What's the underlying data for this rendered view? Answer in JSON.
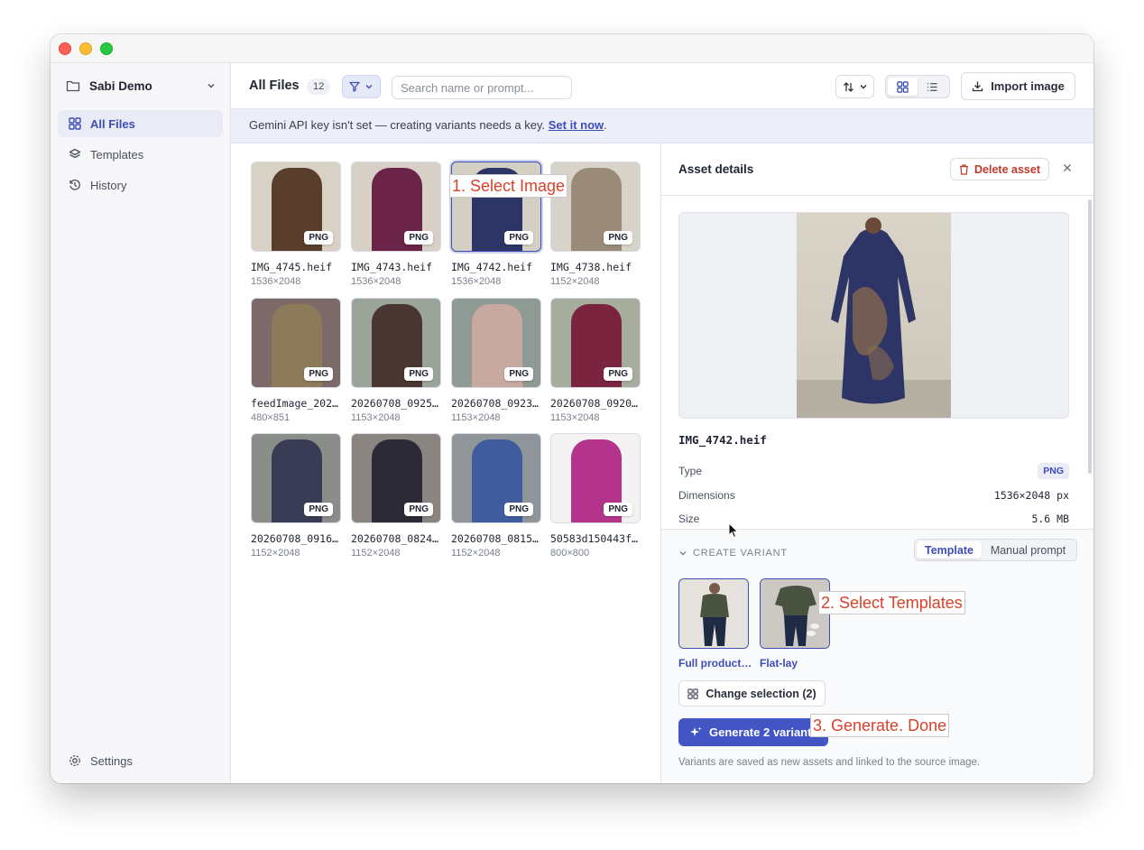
{
  "sidebar": {
    "workspace": "Sabi Demo",
    "items": [
      {
        "label": "All Files",
        "icon": "grid-icon",
        "active": true
      },
      {
        "label": "Templates",
        "icon": "layers-icon",
        "active": false
      },
      {
        "label": "History",
        "icon": "history-icon",
        "active": false
      }
    ],
    "settings_label": "Settings"
  },
  "toolbar": {
    "title": "All Files",
    "count": "12",
    "search_placeholder": "Search name or prompt...",
    "import_label": "Import image"
  },
  "banner": {
    "text": "Gemini API key isn't set — creating variants needs a key. ",
    "link": "Set it now",
    "tail": "."
  },
  "files": [
    {
      "name": "IMG_4745.heif",
      "dims": "1536×2048",
      "type": "PNG",
      "color": "#5a3e2c",
      "bg": "#d8d2c6"
    },
    {
      "name": "IMG_4743.heif",
      "dims": "1536×2048",
      "type": "PNG",
      "color": "#6b2448",
      "bg": "#d6d0c6"
    },
    {
      "name": "IMG_4742.heif",
      "dims": "1536×2048",
      "type": "PNG",
      "color": "#2c3566",
      "bg": "#d4cfc3",
      "selected": true
    },
    {
      "name": "IMG_4738.heif",
      "dims": "1152×2048",
      "type": "PNG",
      "color": "#9a8b79",
      "bg": "#d8d3ca"
    },
    {
      "name": "feedImage_202…",
      "dims": "480×851",
      "type": "PNG",
      "color": "#8c7a5a",
      "bg": "#7b6a68"
    },
    {
      "name": "20260708_0925…",
      "dims": "1153×2048",
      "type": "PNG",
      "color": "#4a3630",
      "bg": "#9aa49a"
    },
    {
      "name": "20260708_0923…",
      "dims": "1153×2048",
      "type": "PNG",
      "color": "#c7a9a0",
      "bg": "#8f9a94"
    },
    {
      "name": "20260708_0920…",
      "dims": "1153×2048",
      "type": "PNG",
      "color": "#7a2440",
      "bg": "#a7ad9c"
    },
    {
      "name": "20260708_0916…",
      "dims": "1152×2048",
      "type": "PNG",
      "color": "#3a3c55",
      "bg": "#8b8d88"
    },
    {
      "name": "20260708_0824…",
      "dims": "1152×2048",
      "type": "PNG",
      "color": "#2c2a36",
      "bg": "#8a8580"
    },
    {
      "name": "20260708_0815…",
      "dims": "1152×2048",
      "type": "PNG",
      "color": "#3f5c9e",
      "bg": "#8f9599"
    },
    {
      "name": "50583d150443f…",
      "dims": "800×800",
      "type": "PNG",
      "color": "#b4348c",
      "bg": "#f4f2f2"
    }
  ],
  "details": {
    "title": "Asset details",
    "delete_label": "Delete asset",
    "filename": "IMG_4742.heif",
    "rows": [
      {
        "label": "Type",
        "value": "PNG"
      },
      {
        "label": "Dimensions",
        "value": "1536×2048 px"
      },
      {
        "label": "Size",
        "value": "5.6 MB"
      }
    ]
  },
  "variant": {
    "section_label": "CREATE VARIANT",
    "modes": [
      "Template",
      "Manual prompt"
    ],
    "active_mode": "Template",
    "templates": [
      {
        "label": "Full product…"
      },
      {
        "label": "Flat-lay"
      }
    ],
    "change_label": "Change selection (2)",
    "generate_label": "Generate 2 variants",
    "footnote": "Variants are saved as new assets and linked to the source image."
  },
  "annotations": [
    {
      "text": "1. Select Image"
    },
    {
      "text": "2. Select Templates"
    },
    {
      "text": "3. Generate. Done"
    }
  ],
  "colors": {
    "accent": "#3d4db7",
    "danger": "#c0392b",
    "annotation": "#d9412b"
  }
}
